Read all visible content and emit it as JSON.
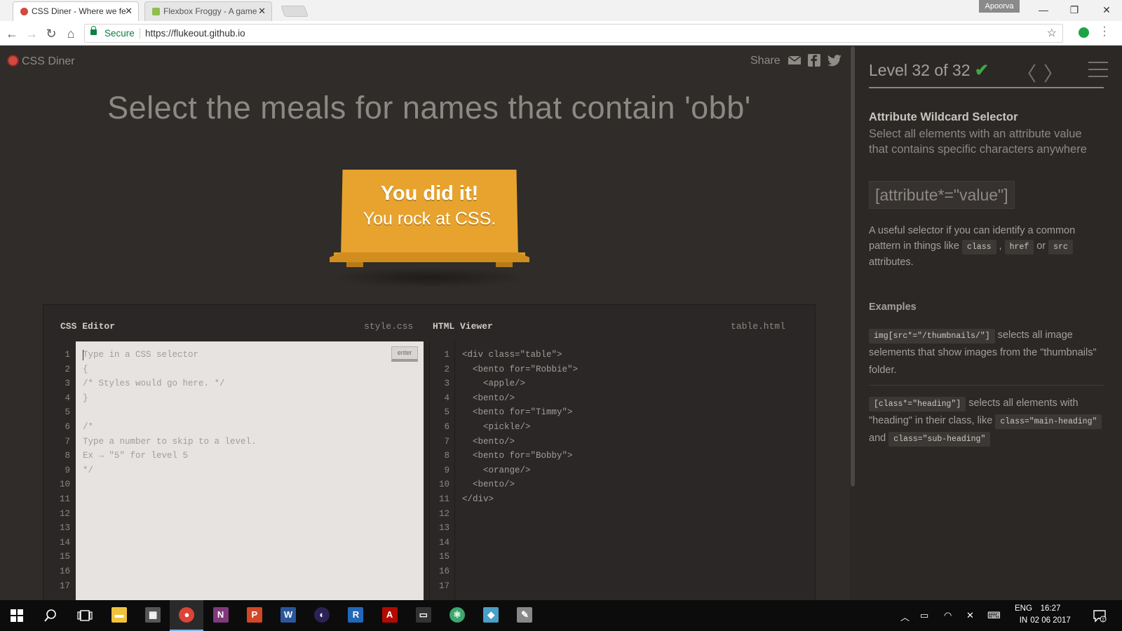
{
  "browser": {
    "tabs": [
      {
        "title": "CSS Diner - Where we fe",
        "favicon_color": "#d3483f",
        "active": true
      },
      {
        "title": "Flexbox Froggy - A game",
        "favicon_color": "#8fbf4d",
        "active": false
      }
    ],
    "tab_close": "✕",
    "profile": "Apoorva",
    "window_controls": {
      "minimize": "—",
      "restore": "❐",
      "close": "✕"
    },
    "nav": {
      "back": "←",
      "forward": "→",
      "reload": "↻",
      "home": "⌂"
    },
    "secure_label": "Secure",
    "url": "https://flukeout.github.io",
    "bookmark_star": "☆"
  },
  "header": {
    "logo_text": "CSS Diner",
    "share_label": "Share"
  },
  "instruction": "Select the meals for names that contain 'obb'",
  "win_message": {
    "line1": "You did it!",
    "line2": "You rock at CSS."
  },
  "css_editor": {
    "title": "CSS Editor",
    "filename": "style.css",
    "enter_label": "enter",
    "lines": [
      "Type in a CSS selector",
      "{",
      "/* Styles would go here. */",
      "}",
      "",
      "/*",
      "Type a number to skip to a level.",
      "Ex → \"5\" for level 5",
      "*/",
      "",
      "",
      "",
      "",
      "",
      "",
      "",
      ""
    ]
  },
  "html_viewer": {
    "title": "HTML Viewer",
    "filename": "table.html",
    "lines": [
      "<div class=\"table\">",
      "  <bento for=\"Robbie\">",
      "    <apple/>",
      "  <bento/>",
      "  <bento for=\"Timmy\">",
      "    <pickle/>",
      "  <bento/>",
      "  <bento for=\"Bobby\">",
      "    <orange/>",
      "  <bento/>",
      "</div>",
      "",
      "",
      "",
      "",
      "",
      ""
    ]
  },
  "line_numbers": [
    "1",
    "2",
    "3",
    "4",
    "5",
    "6",
    "7",
    "8",
    "9",
    "10",
    "11",
    "12",
    "13",
    "14",
    "15",
    "16",
    "17"
  ],
  "sidebar": {
    "level_title": "Level 32 of 32",
    "check": "✔",
    "prev": "〈",
    "next": "〉",
    "progress": 1.0,
    "selector_name": "Attribute Wildcard Selector",
    "selector_title": "Select all elements with an attribute value that contains specific characters anywhere",
    "syntax": "[attribute*=\"value\"]",
    "hint": {
      "before": "A useful selector if you can identify a common pattern in things like ",
      "chip1": "class",
      "comma": " , ",
      "chip2": "href",
      "or": " or ",
      "chip3": "src",
      "after": " attributes."
    },
    "examples_heading": "Examples",
    "example1": {
      "code": "img[src*=\"/thumbnails/\"]",
      "text": " selects all image selements that show images from the \"thumbnails\" folder."
    },
    "example2": {
      "code": "[class*=\"heading\"]",
      "text1": " selects all elements with \"heading\" in their class, like ",
      "code2": "class=\"main-heading\"",
      "and": " and ",
      "code3": "class=\"sub-heading\""
    }
  },
  "taskbar": {
    "apps": [
      {
        "name": "file-explorer",
        "glyph": "▬",
        "color": "#f0c33c"
      },
      {
        "name": "calculator",
        "glyph": "▦",
        "color": "#555555"
      },
      {
        "name": "chrome",
        "glyph": "●",
        "color": "#db4437"
      },
      {
        "name": "onenote",
        "glyph": "N",
        "color": "#80397b"
      },
      {
        "name": "powerpoint",
        "glyph": "P",
        "color": "#d24726"
      },
      {
        "name": "word",
        "glyph": "W",
        "color": "#2b579a"
      },
      {
        "name": "eclipse",
        "glyph": "◐",
        "color": "#2c2255"
      },
      {
        "name": "r-studio",
        "glyph": "R",
        "color": "#2268b8"
      },
      {
        "name": "acrobat",
        "glyph": "A",
        "color": "#b30b00"
      },
      {
        "name": "command-prompt",
        "glyph": "▭",
        "color": "#333333"
      },
      {
        "name": "atom",
        "glyph": "⚛",
        "color": "#3ca86b"
      },
      {
        "name": "notepad",
        "glyph": "◆",
        "color": "#4aa0c8"
      },
      {
        "name": "paint",
        "glyph": "✎",
        "color": "#888888"
      }
    ],
    "language": {
      "line1": "ENG",
      "line2": "IN"
    },
    "time": "16:27",
    "date": "02 06 2017"
  }
}
